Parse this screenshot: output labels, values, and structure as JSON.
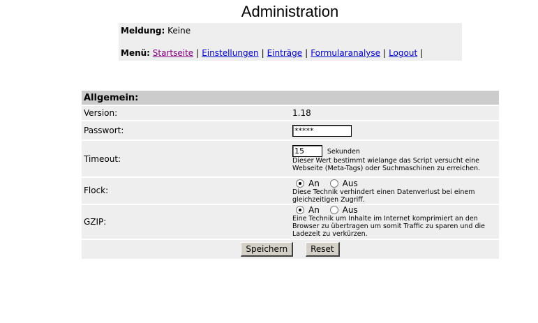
{
  "page": {
    "title": "Administration"
  },
  "message": {
    "label": "Meldung:",
    "value": "Keine"
  },
  "menu": {
    "label": "Menü:",
    "items": [
      {
        "label": "Startseite",
        "visited": true
      },
      {
        "label": "Einstellungen"
      },
      {
        "label": "Einträge"
      },
      {
        "label": "Formularanalyse"
      },
      {
        "label": "Logout"
      }
    ],
    "separator": "|"
  },
  "form": {
    "section_title": "Allgemein:",
    "version": {
      "label": "Version:",
      "value": "1.18"
    },
    "password": {
      "label": "Passwort:",
      "value": "*****"
    },
    "timeout": {
      "label": "Timeout:",
      "value": "15",
      "unit": "Sekunden",
      "help": "Dieser Wert bestimmt wielange das Script versucht eine Webseite (Meta-Tags) oder Suchmaschinen zu erreichen."
    },
    "flock": {
      "label": "Flock:",
      "on_label": "An",
      "off_label": "Aus",
      "selected": "An",
      "help": "Diese Technik verhindert einen Datenverlust bei einem gleichzeitigen Zugriff."
    },
    "gzip": {
      "label": "GZIP:",
      "on_label": "An",
      "off_label": "Aus",
      "selected": "An",
      "help": "Eine Technik um Inhalte im Internet komprimiert an den Browser zu übertragen um somit Traffic zu sparen und die Ladezeit zu verkürzen."
    },
    "save_label": "Speichern",
    "reset_label": "Reset"
  }
}
